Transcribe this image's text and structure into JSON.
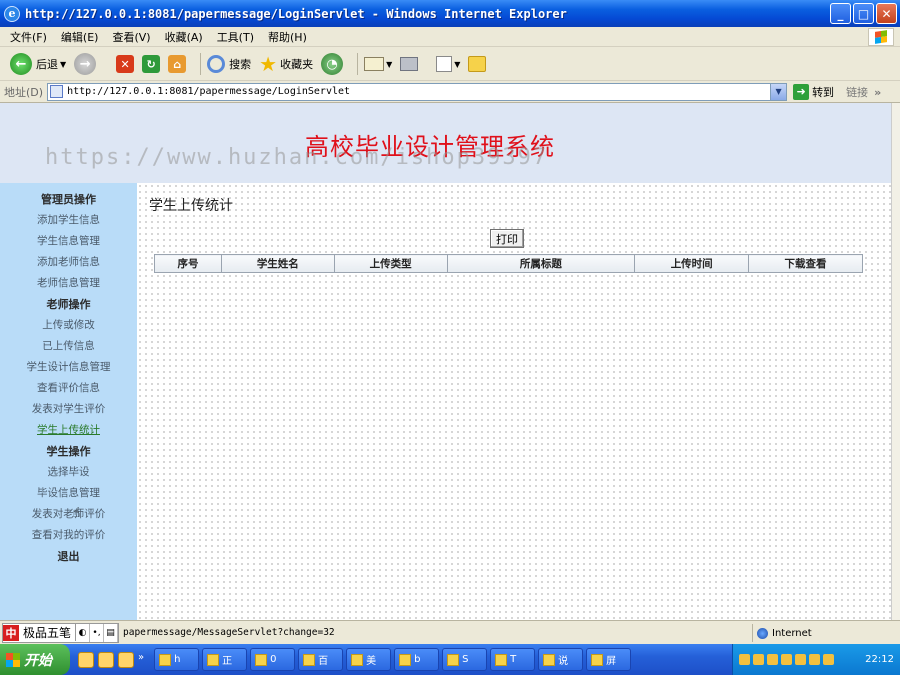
{
  "window": {
    "title": "http://127.0.0.1:8081/papermessage/LoginServlet - Windows Internet Explorer"
  },
  "menubar": {
    "items": [
      "文件(F)",
      "编辑(E)",
      "查看(V)",
      "收藏(A)",
      "工具(T)",
      "帮助(H)"
    ]
  },
  "toolbar": {
    "back_label": "后退",
    "search_label": "搜索",
    "favorites_label": "收藏夹"
  },
  "address": {
    "label": "地址(D)",
    "url": "http://127.0.0.1:8081/papermessage/LoginServlet",
    "go_label": "转到",
    "links_label": "链接"
  },
  "site": {
    "title": "高校毕业设计管理系统",
    "watermark": "https://www.huzhan.com/ishop39397"
  },
  "sidebar": {
    "admin_header": "管理员操作",
    "admin_items": [
      "添加学生信息",
      "学生信息管理",
      "添加老师信息",
      "老师信息管理"
    ],
    "teacher_header": "老师操作",
    "teacher_items": [
      "上传或修改",
      "已上传信息",
      "学生设计信息管理",
      "查看评价信息",
      "发表对学生评价",
      "学生上传统计"
    ],
    "student_header": "学生操作",
    "student_items": [
      "选择毕设",
      "毕设信息管理",
      "发表对老师评价",
      "查看对我的评价"
    ],
    "logout": "退出"
  },
  "main": {
    "title": "学生上传统计",
    "print_label": "打印",
    "columns": [
      "序号",
      "学生姓名",
      "上传类型",
      "所属标题",
      "上传时间",
      "下载查看"
    ]
  },
  "statusbar": {
    "ime_name": "极品五笔",
    "url": "papermessage/MessageServlet?change=32",
    "zone": "Internet"
  },
  "taskbar": {
    "start_label": "开始",
    "buttons": [
      "h",
      "正",
      "0",
      "百",
      "美",
      "b",
      "S",
      "T",
      "说",
      "屏"
    ],
    "time": "22:12"
  },
  "colors": {
    "title_red": "#e0101a",
    "sidebar_bg": "#b9dcf8",
    "header_bg": "#dde6f4"
  }
}
